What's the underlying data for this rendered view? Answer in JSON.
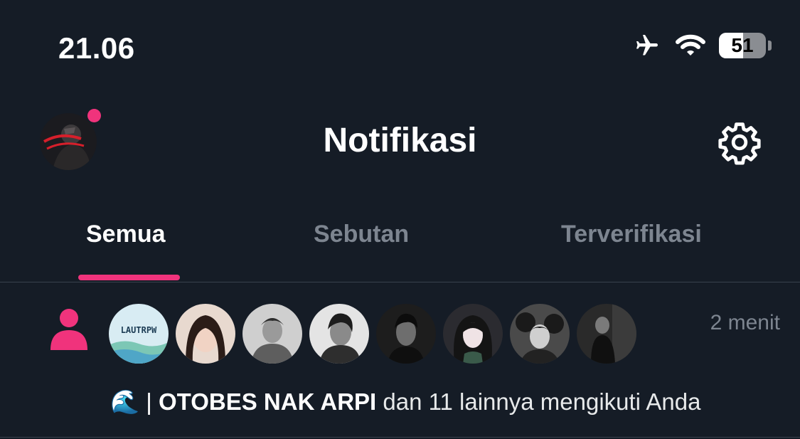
{
  "status_bar": {
    "time": "21.06",
    "battery_level": "51",
    "icons": [
      "airplane-mode-icon",
      "wifi-icon",
      "battery-icon"
    ]
  },
  "header": {
    "title": "Notifikasi",
    "has_unread_dot": true
  },
  "tabs": [
    {
      "label": "Semua",
      "active": true
    },
    {
      "label": "Sebutan",
      "active": false
    },
    {
      "label": "Terverifikasi",
      "active": false
    }
  ],
  "notification": {
    "time_ago": "2 menit",
    "emoji": "🌊",
    "separator": " | ",
    "name": "OTOBES NAK ARPI",
    "rest": " dan 11 lainnya mengikuti Anda",
    "avatar_count": 8,
    "first_avatar_text": "LAUTRPW"
  },
  "colors": {
    "background": "#151c26",
    "accent": "#f0337c",
    "muted_text": "#7d8590",
    "divider": "#38414d"
  }
}
